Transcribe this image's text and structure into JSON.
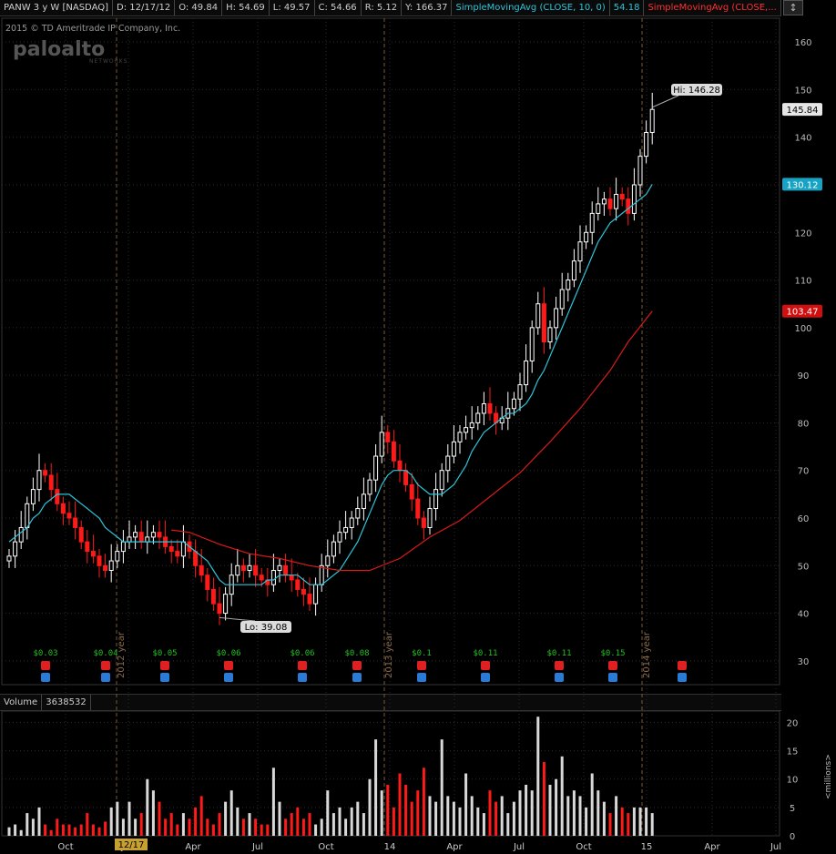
{
  "header": {
    "symbol": "PANW 3 y W [NASDAQ]",
    "date": "D: 12/17/12",
    "open": "O: 49.84",
    "high": "H: 54.69",
    "low": "L: 49.57",
    "close": "C: 54.66",
    "range": "R: 5.12",
    "y": "Y: 166.37",
    "sma1_label": "SimpleMovingAvg (CLOSE, 10, 0)",
    "sma1_value": "54.18",
    "sma2_label": "SimpleMovingAvg (CLOSE,..."
  },
  "copyright": "2015 © TD Ameritrade IP Company, Inc.",
  "logo": {
    "text": "paloalto",
    "sub": "NETWORKS"
  },
  "volume_header": {
    "label": "Volume",
    "value": "3638532"
  },
  "colors": {
    "up": "#ffffff",
    "down": "#ff1a1a",
    "sma10": "#2ec4d8",
    "sma40": "#d81b1b",
    "last_price_bg": "#e6e6e6",
    "sma10_badge": "#17a3c4",
    "sma40_badge": "#d01010",
    "grid": "#2a2a2a",
    "separator": "#7a5a3a",
    "dividend": "#22c022"
  },
  "price_badges": {
    "last": "145.84",
    "sma10": "130.12",
    "sma40": "103.47"
  },
  "annotations": {
    "high": "Hi: 146.28",
    "low": "Lo: 39.08"
  },
  "year_markers": [
    "2012 year",
    "2013 year",
    "2014 year"
  ],
  "selected_date_label": "12/17",
  "dividend_labels": [
    "$0.03",
    "$0.04",
    "$0.05",
    "$0.06",
    "$0.06",
    "$0.08",
    "$0.1",
    "$0.11",
    "$0.11",
    "$0.15"
  ],
  "chart_data": {
    "type": "candlestick",
    "title": "PANW 3 y W [NASDAQ]",
    "x_tick_labels": [
      "Oct",
      "Jan",
      "Apr",
      "Jul",
      "Oct",
      "14",
      "Apr",
      "Jul",
      "Oct",
      "15",
      "Apr",
      "Jul"
    ],
    "price_axis": {
      "ticks": [
        30,
        40,
        50,
        60,
        70,
        80,
        90,
        100,
        110,
        120,
        130,
        140,
        150,
        160
      ],
      "range": [
        25,
        165
      ]
    },
    "volume_axis": {
      "ticks": [
        0,
        5,
        10,
        15,
        20
      ],
      "range": [
        0,
        22
      ],
      "unit_label": "<millions>"
    },
    "series": [
      {
        "name": "Price (weekly close)",
        "values": [
          52,
          55,
          58,
          63,
          66,
          70,
          69,
          66,
          63,
          61,
          60,
          58,
          55,
          53,
          52,
          50,
          49,
          51,
          53,
          55,
          56,
          57,
          55,
          56,
          57,
          56,
          54,
          53,
          52,
          55,
          53,
          50,
          48,
          45,
          42,
          40,
          44,
          48,
          50,
          49,
          50,
          48,
          47,
          46,
          49,
          50,
          48,
          47,
          45,
          44,
          42,
          46,
          50,
          52,
          55,
          57,
          58,
          60,
          62,
          65,
          68,
          73,
          78,
          76,
          72,
          70,
          67,
          64,
          60,
          58,
          62,
          66,
          70,
          73,
          76,
          78,
          79,
          80,
          82,
          84,
          82,
          80,
          81,
          83,
          85,
          88,
          93,
          100,
          105,
          97,
          100,
          104,
          108,
          110,
          114,
          118,
          120,
          124,
          126,
          127,
          125,
          128,
          127,
          124,
          130,
          136,
          141,
          145.84
        ]
      },
      {
        "name": "SimpleMovingAvg (CLOSE, 10, 0)",
        "values": [
          55,
          56,
          57,
          58,
          60,
          61,
          63,
          64,
          65,
          65,
          65,
          64,
          63,
          62,
          61,
          60,
          58,
          57,
          56,
          55,
          55,
          55,
          55,
          55,
          55,
          55,
          55,
          55,
          55,
          55,
          54,
          53,
          52,
          51,
          49,
          47,
          46,
          46,
          46,
          46,
          46,
          46,
          46,
          47,
          47,
          48,
          48,
          48,
          48,
          47,
          46,
          46,
          46,
          47,
          48,
          49,
          51,
          53,
          55,
          58,
          61,
          64,
          67,
          69,
          70,
          70,
          70,
          69,
          67,
          66,
          65,
          65,
          65,
          66,
          67,
          69,
          71,
          74,
          76,
          78,
          79,
          80,
          81,
          82,
          82,
          83,
          84,
          86,
          89,
          91,
          94,
          97,
          100,
          103,
          106,
          109,
          112,
          115,
          118,
          120,
          122,
          123,
          124,
          125,
          126,
          127,
          128,
          130.12
        ]
      },
      {
        "name": "SimpleMovingAvg (CLOSE,...)",
        "values": [
          null,
          null,
          null,
          null,
          null,
          null,
          null,
          null,
          null,
          null,
          null,
          null,
          null,
          null,
          null,
          null,
          null,
          null,
          null,
          null,
          null,
          null,
          null,
          null,
          null,
          null,
          null,
          null,
          null,
          null,
          null,
          null,
          null,
          null,
          null,
          null,
          null,
          null,
          null,
          null,
          null,
          null,
          null,
          null,
          null,
          null,
          null,
          null,
          null,
          null,
          null,
          null,
          null,
          null,
          null,
          null,
          null,
          null,
          null,
          null,
          null,
          null,
          null,
          null,
          null,
          null,
          null,
          null,
          null,
          null,
          null,
          null,
          null,
          null,
          null,
          null,
          null,
          null,
          null,
          null,
          null,
          null,
          null,
          null,
          null,
          null,
          null,
          null,
          null,
          null,
          null,
          null,
          null,
          null,
          null,
          null,
          null,
          null,
          null,
          null,
          null,
          null,
          null,
          null,
          null,
          null,
          null,
          null
        ],
        "sampled_points": [
          [
            27,
            57.5
          ],
          [
            30,
            57
          ],
          [
            35,
            54.5
          ],
          [
            40,
            52.5
          ],
          [
            45,
            51.5
          ],
          [
            50,
            50
          ],
          [
            55,
            49
          ],
          [
            60,
            49
          ],
          [
            65,
            51.5
          ],
          [
            70,
            56
          ],
          [
            75,
            59.5
          ],
          [
            80,
            64.5
          ],
          [
            85,
            69.5
          ],
          [
            90,
            76
          ],
          [
            95,
            83
          ],
          [
            100,
            91
          ],
          [
            103,
            97
          ],
          [
            107,
            103.47
          ]
        ]
      },
      {
        "name": "Volume (millions)",
        "values": [
          1.5,
          2,
          1,
          4,
          3,
          5,
          2,
          1,
          3,
          2,
          2,
          1.5,
          2,
          4,
          2,
          1.5,
          2.5,
          5,
          6,
          3,
          6,
          3,
          4,
          10,
          8,
          6,
          3,
          4,
          2,
          4,
          3,
          5,
          7,
          3,
          2,
          4,
          6,
          8,
          5,
          3,
          4,
          3,
          2,
          2,
          12,
          6,
          3,
          4,
          5,
          3,
          4,
          2,
          3,
          8,
          4,
          5,
          3,
          5,
          6,
          4,
          10,
          17,
          8,
          9,
          5,
          11,
          9,
          6,
          8,
          12,
          7,
          6,
          17,
          7,
          6,
          5,
          11,
          7,
          5,
          4,
          8,
          6,
          7,
          4,
          6,
          8,
          9,
          8,
          21,
          13,
          9,
          10,
          14,
          7,
          8,
          7,
          5,
          11,
          8,
          6,
          4,
          7,
          5,
          4,
          5,
          5,
          5,
          4
        ]
      }
    ]
  }
}
